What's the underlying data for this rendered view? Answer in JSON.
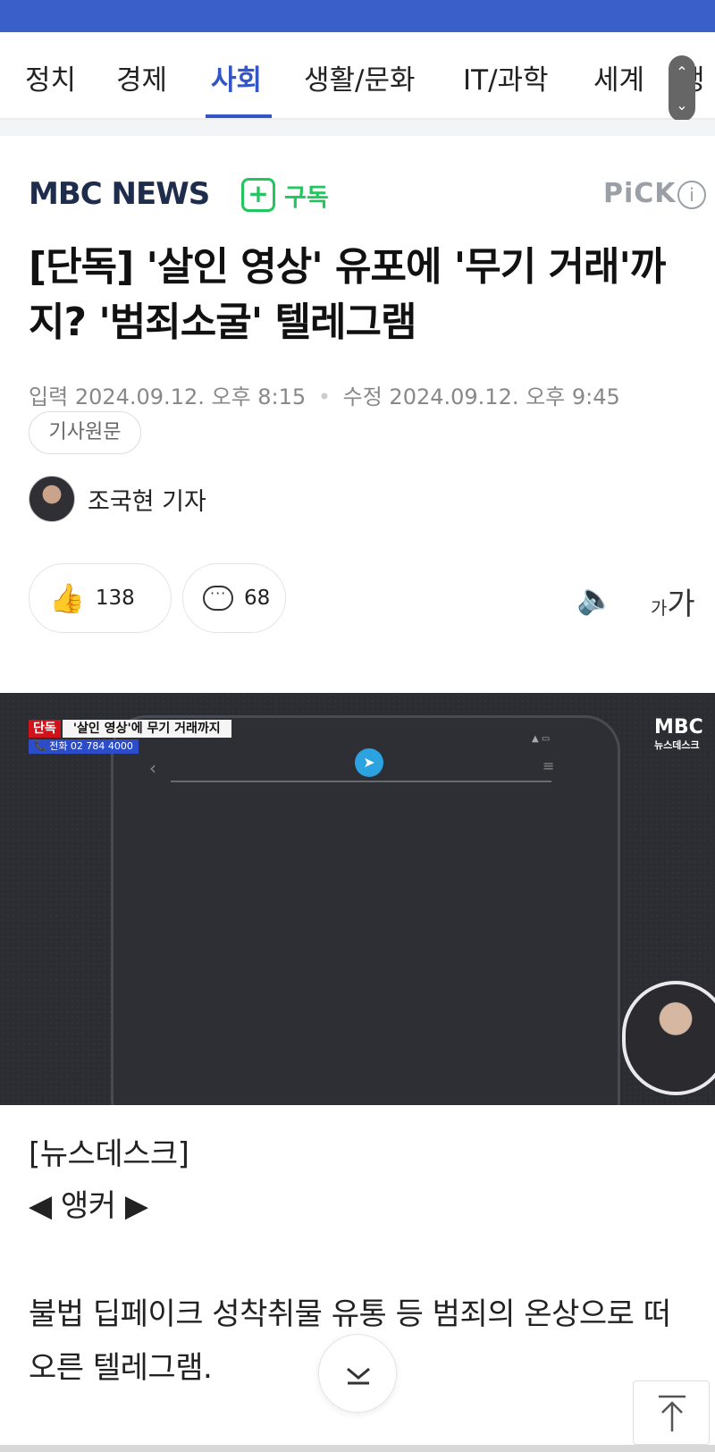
{
  "nav": {
    "tabs": [
      "정치",
      "경제",
      "사회",
      "생활/문화",
      "IT/과학",
      "세계",
      "랭"
    ],
    "active_tab": "사회",
    "scroll_up": "⌃",
    "scroll_down": "⌄"
  },
  "press": {
    "logo_text": "MBC NEWS",
    "subscribe_label": "구독",
    "pick_label": "PiCK",
    "info_label": "i"
  },
  "article": {
    "headline": "[단독] '살인 영상' 유포에 '무기 거래'까지? '범죄소굴' 텔레그램",
    "input_label": "입력",
    "input_date": "2024.09.12. 오후 8:15",
    "edit_label": "수정",
    "edit_date": "2024.09.12. 오후 9:45",
    "original_button": "기사원문",
    "reporter": "조국현 기자",
    "like_count": "138",
    "comment_count": "68"
  },
  "video": {
    "exclusive_badge": "단독",
    "ticker_title": "'살인 영상'에 무기 거래까지",
    "phone_line": "📞 전화 02 784 4000",
    "corner_logo": "MBC",
    "corner_sub": "뉴스데스크"
  },
  "body": {
    "program": "[뉴스데스크]",
    "anchor": "◀ 앵커 ▶",
    "paragraph": "불법 딥페이크 성착취물 유통 등 범죄의 온상으로 떠오른 텔레그램."
  },
  "colors": {
    "accent_blue": "#3355c5",
    "subscribe_green": "#22c55e",
    "top_bar": "#3b5fc9"
  }
}
